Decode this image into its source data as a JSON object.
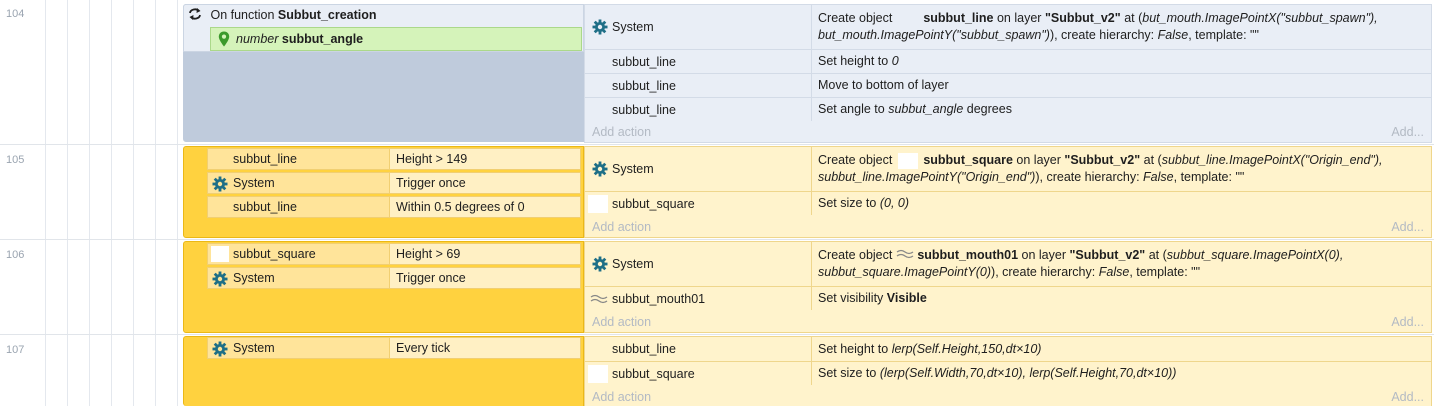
{
  "events": [
    {
      "line": "104",
      "function_prefix": "On function",
      "function_name": "Subbut_creation",
      "param_type": "number",
      "param_name": "subbut_angle",
      "actions": [
        {
          "object": "System",
          "obj_icon": "gear-icon",
          "parts": {
            "a": "Create object",
            "name": "subbut_line",
            "b": "on layer",
            "layer": "\"Subbut_v2\"",
            "c": "at (",
            "x": "but_mouth.ImagePointX(\"subbut_spawn\"),",
            "y": "but_mouth.ImagePointY(\"subbut_spawn\")",
            "d": "), create hierarchy:",
            "h": "False",
            "e": ", template: \"\""
          }
        },
        {
          "object": "subbut_line",
          "pre": "Set height to",
          "val": "0"
        },
        {
          "object": "subbut_line",
          "pre": "Move to bottom of layer"
        },
        {
          "object": "subbut_line",
          "pre": "Set angle to",
          "val": "subbut_angle",
          "post": "degrees"
        }
      ],
      "add_action": "Add action",
      "add_right": "Add..."
    },
    {
      "line": "105",
      "conditions": [
        {
          "object": "subbut_line",
          "text": "Height > 149"
        },
        {
          "object": "System",
          "text": "Trigger once"
        },
        {
          "object": "subbut_line",
          "text": "Within 0.5 degrees of 0"
        }
      ],
      "actions": [
        {
          "object": "System",
          "parts": {
            "a": "Create object",
            "name": "subbut_square",
            "b": "on layer",
            "layer": "\"Subbut_v2\"",
            "c": "at (",
            "x": "subbut_line.ImagePointX(\"Origin_end\"),",
            "y": "subbut_line.ImagePointY(\"Origin_end\")",
            "d": "), create hierarchy:",
            "h": "False",
            "e": ", template: \"\""
          }
        },
        {
          "object": "subbut_square",
          "pre": "Set size to",
          "val": "(0, 0)"
        }
      ],
      "add_action": "Add action",
      "add_right": "Add..."
    },
    {
      "line": "106",
      "conditions": [
        {
          "object": "subbut_square",
          "text": "Height > 69"
        },
        {
          "object": "System",
          "text": "Trigger once"
        }
      ],
      "actions": [
        {
          "object": "System",
          "parts": {
            "a": "Create object",
            "name": "subbut_mouth01",
            "b": "on layer",
            "layer": "\"Subbut_v2\"",
            "c": "at (",
            "x": "subbut_square.ImagePointX(0),",
            "y": "subbut_square.ImagePointY(0)",
            "d": "), create hierarchy:",
            "h": "False",
            "e": ", template: \"\""
          }
        },
        {
          "object": "subbut_mouth01",
          "pre": "Set visibility",
          "bold": "Visible"
        }
      ],
      "add_action": "Add action",
      "add_right": "Add..."
    },
    {
      "line": "107",
      "conditions": [
        {
          "object": "System",
          "text": "Every tick"
        }
      ],
      "actions": [
        {
          "object": "subbut_line",
          "pre": "Set height to",
          "val": "lerp(Self.Height,150,dt×10)"
        },
        {
          "object": "subbut_square",
          "pre": "Set size to",
          "val": "(lerp(Self.Width,70,dt×10), lerp(Self.Height,70,dt×10))"
        }
      ],
      "add_action": "Add action",
      "add_right": "Add..."
    }
  ],
  "colors": {
    "function_block": "#bfcbdc",
    "condition_block": "#ffd23f",
    "param_green": "#d5f3ba",
    "gear": "#1f6f87"
  }
}
